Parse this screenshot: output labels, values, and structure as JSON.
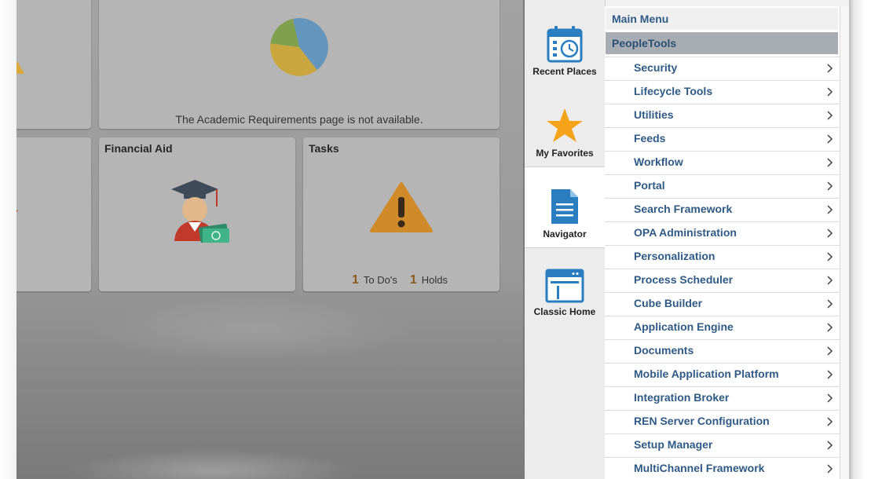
{
  "tiles": {
    "academic_requirements": {
      "message": "The Academic Requirements page is not available."
    },
    "financial_aid": {
      "title": "Financial Aid"
    },
    "tasks": {
      "title": "Tasks",
      "todos_count": "1",
      "todos_label": "To Do's",
      "holds_count": "1",
      "holds_label": "Holds"
    }
  },
  "nav_bar": {
    "buttons": [
      {
        "label": "Recent Places",
        "icon": "calendar-clock-icon"
      },
      {
        "label": "My Favorites",
        "icon": "star-icon"
      },
      {
        "label": "Navigator",
        "icon": "document-icon",
        "active": true
      },
      {
        "label": "Classic Home",
        "icon": "browser-window-icon"
      }
    ]
  },
  "menu": {
    "main_menu": "Main Menu",
    "current_folder": "PeopleTools",
    "items": [
      "Security",
      "Lifecycle Tools",
      "Utilities",
      "Feeds",
      "Workflow",
      "Portal",
      "Search Framework",
      "OPA Administration",
      "Personalization",
      "Process Scheduler",
      "Cube Builder",
      "Application Engine",
      "Documents",
      "Mobile Application Platform",
      "Integration Broker",
      "REN Server Configuration",
      "Setup Manager",
      "MultiChannel Framework"
    ]
  },
  "colors": {
    "menu_text": "#2f5a86",
    "selected_folder_bg": "#a7adb3",
    "tile_bg": "#b5b5b5",
    "accent_star": "#f5a41a"
  }
}
